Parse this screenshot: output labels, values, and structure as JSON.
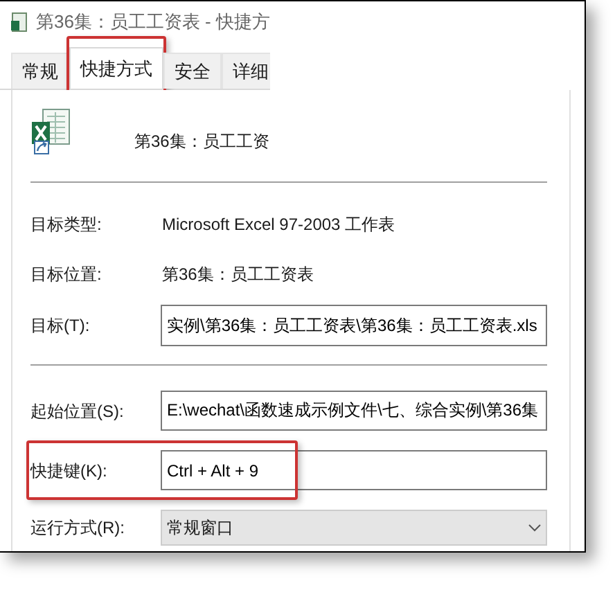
{
  "window": {
    "title": "第36集：员工工资表 - 快捷方"
  },
  "tabs": [
    {
      "label": "常规",
      "selected": false,
      "highlighted": false
    },
    {
      "label": "快捷方式",
      "selected": true,
      "highlighted": true
    },
    {
      "label": "安全",
      "selected": false,
      "highlighted": false
    },
    {
      "label": "详细",
      "selected": false,
      "highlighted": false
    }
  ],
  "file_name": "第36集：员工工资",
  "target_rows": [
    {
      "kind": "text",
      "label": "目标类型:",
      "value": "Microsoft Excel 97-2003 工作表",
      "highlighted": false
    },
    {
      "kind": "text",
      "label": "目标位置:",
      "value": "第36集：员工工资表",
      "highlighted": false
    },
    {
      "kind": "field",
      "label": "目标(T):",
      "value": "实例\\第36集：员工工资表\\第36集：员工工资表.xls",
      "highlighted": false
    }
  ],
  "start_rows": [
    {
      "kind": "field",
      "label": "起始位置(S):",
      "value": "E:\\wechat\\函数速成示例文件\\七、综合实例\\第36集",
      "highlighted": false
    },
    {
      "kind": "field",
      "label": "快捷键(K):",
      "value": "Ctrl + Alt + 9",
      "highlighted": true
    },
    {
      "kind": "select",
      "label": "运行方式(R):",
      "value": "常规窗口",
      "highlighted": false
    }
  ]
}
